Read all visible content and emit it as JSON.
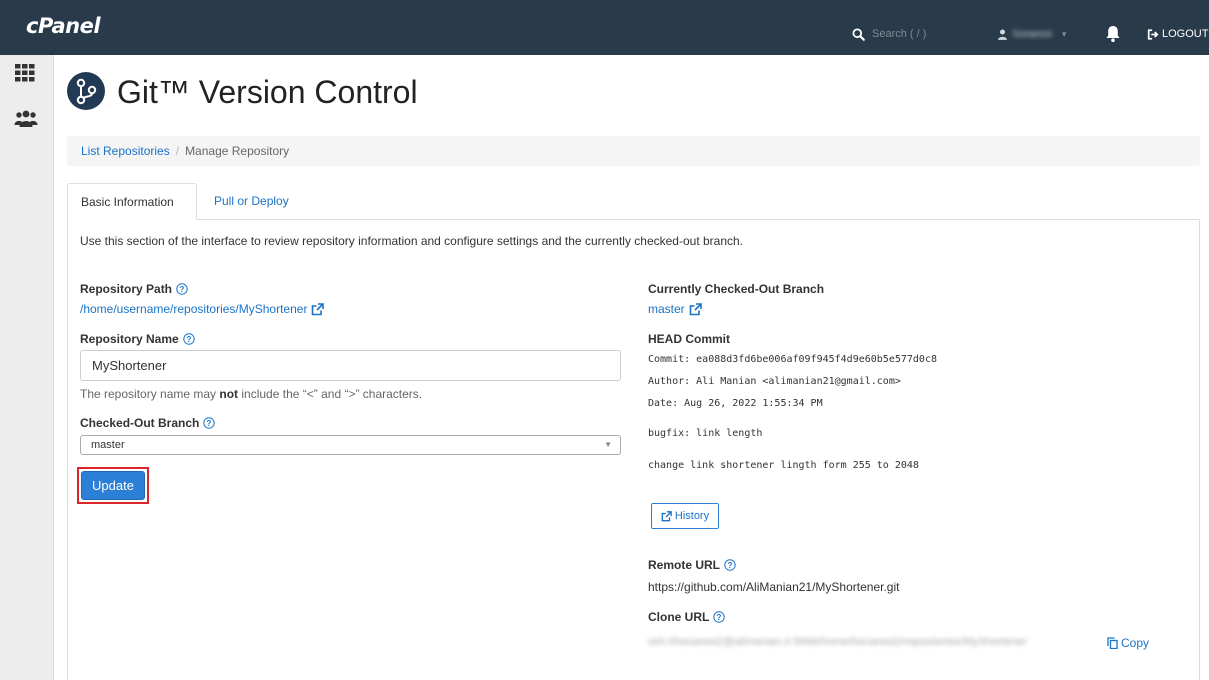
{
  "app": {
    "logo": "cPanel"
  },
  "topbar": {
    "search_placeholder": "Search ( / )",
    "user_name": "honareoi",
    "logout_label": "LOGOUT"
  },
  "page": {
    "title": "Git™ Version Control"
  },
  "breadcrumb": {
    "list_label": "List Repositories",
    "separator": "/",
    "current": "Manage Repository"
  },
  "tabs": [
    {
      "label": "Basic Information",
      "active": true
    },
    {
      "label": "Pull or Deploy",
      "active": false
    }
  ],
  "intro": "Use this section of the interface to review repository information and configure settings and the currently checked-out branch.",
  "left": {
    "repo_path_label": "Repository Path",
    "repo_path_value": "/home/username/repositories/MyShortener",
    "repo_name_label": "Repository Name",
    "repo_name_value": "MyShortener",
    "hint_before": "The repository name may ",
    "hint_bold": "not",
    "hint_after": " include the “<” and “>” characters.",
    "branch_label": "Checked-Out Branch",
    "branch_value": "master",
    "update_label": "Update"
  },
  "right": {
    "current_branch_label": "Currently Checked-Out Branch",
    "current_branch_value": "master",
    "head_commit_label": "HEAD Commit",
    "commit_line": "Commit: ea088d3fd6be006af09f945f4d9e60b5e577d0c8",
    "author_line": "Author: Ali Manian <alimanian21@gmail.com>",
    "date_line": "Date: Aug 26, 2022 1:55:34 PM",
    "message_subject": "bugfix: link length",
    "message_body": "change link shortener lingth form 255 to 2048",
    "history_label": "History",
    "remote_url_label": "Remote URL",
    "remote_url_value": "https://github.com/AliManian21/MyShortener.git",
    "clone_url_label": "Clone URL",
    "clone_url_value": "ssh://honareoi2@alimanian.ir:9966/home/honareoi2/repositories/MyShortener",
    "copy_label": "Copy"
  },
  "colors": {
    "topbar": "#293a4a",
    "link": "#1a73c9",
    "primary": "#2c7fd6",
    "highlight": "#d9262c"
  },
  "icons": [
    "search-icon",
    "user-icon",
    "bell-icon",
    "logout-icon",
    "grid-icon",
    "users-icon",
    "git-icon",
    "help-icon",
    "external-link-icon",
    "copy-icon"
  ]
}
